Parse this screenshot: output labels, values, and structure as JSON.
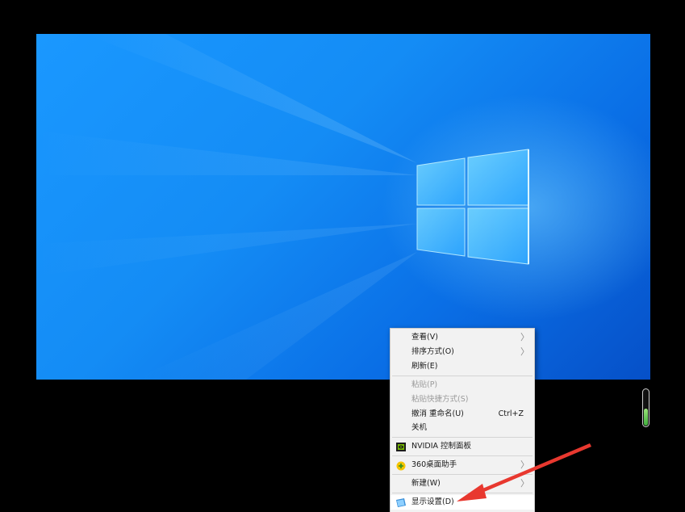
{
  "desktop": {
    "wallpaper": "windows-10-hero-wallpaper",
    "accent": "#1a98ff"
  },
  "context_menu": {
    "items": [
      {
        "label": "查看(V)",
        "has_submenu": true
      },
      {
        "label": "排序方式(O)",
        "has_submenu": true
      },
      {
        "label": "刷新(E)"
      },
      {
        "label": "粘贴(P)",
        "disabled": true
      },
      {
        "label": "粘贴快捷方式(S)",
        "disabled": true
      },
      {
        "label": "撤消 重命名(U)",
        "shortcut": "Ctrl+Z"
      },
      {
        "label": "关机"
      },
      {
        "label": "NVIDIA 控制面板",
        "icon": "nvidia-icon"
      },
      {
        "label": "360桌面助手",
        "icon": "360-assistant-icon",
        "has_submenu": true
      },
      {
        "label": "新建(W)",
        "has_submenu": true
      },
      {
        "label": "显示设置(D)",
        "icon": "display-settings-icon"
      }
    ],
    "submenu_glyph": "〉"
  },
  "annotation": {
    "arrow_color": "#e8382f"
  },
  "volume_indicator": {
    "level": 0.5
  }
}
